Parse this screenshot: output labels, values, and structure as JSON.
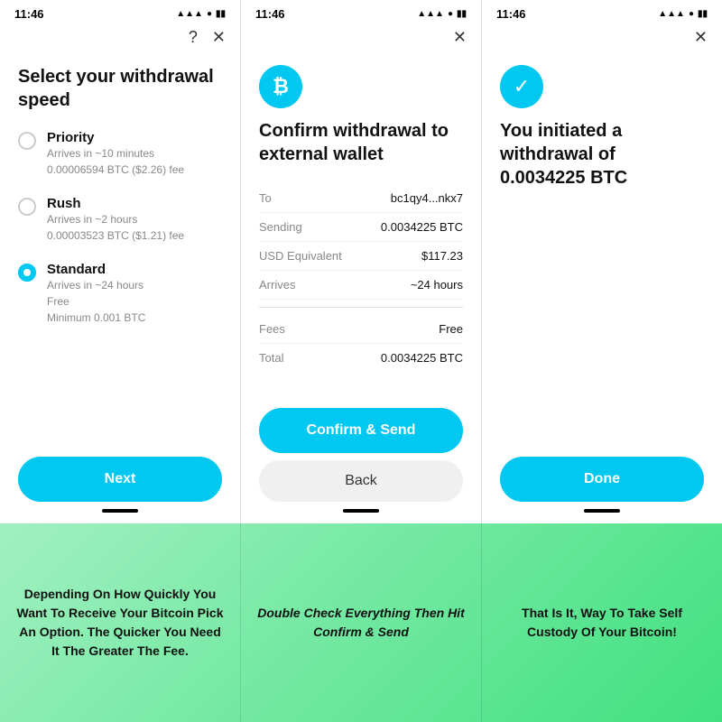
{
  "panels": [
    {
      "id": "panel1",
      "status_time": "11:46",
      "header_icons": [
        "?",
        "×"
      ],
      "title": "Select your withdrawal speed",
      "options": [
        {
          "id": "priority",
          "name": "Priority",
          "desc": "Arrives in ~10 minutes\n0.00006594 BTC ($2.26) fee",
          "selected": false
        },
        {
          "id": "rush",
          "name": "Rush",
          "desc": "Arrives in ~2 hours\n0.00003523 BTC ($1.21) fee",
          "selected": false
        },
        {
          "id": "standard",
          "name": "Standard",
          "desc": "Arrives in ~24 hours\nFree\nMinimum 0.001 BTC",
          "selected": true
        }
      ],
      "primary_button": "Next"
    },
    {
      "id": "panel2",
      "status_time": "11:46",
      "header_icons": [
        "×"
      ],
      "icon_type": "btc",
      "title": "Confirm withdrawal to external wallet",
      "details": [
        {
          "label": "To",
          "value": "bc1qy4...nkx7"
        },
        {
          "label": "Sending",
          "value": "0.0034225 BTC"
        },
        {
          "label": "USD Equivalent",
          "value": "$117.23"
        },
        {
          "label": "Arrives",
          "value": "~24 hours"
        }
      ],
      "fees": [
        {
          "label": "Fees",
          "value": "Free"
        },
        {
          "label": "Total",
          "value": "0.0034225 BTC"
        }
      ],
      "primary_button": "Confirm & Send",
      "secondary_button": "Back"
    },
    {
      "id": "panel3",
      "status_time": "11:46",
      "header_icons": [
        "×"
      ],
      "icon_type": "check",
      "title": "You initiated a withdrawal of 0.0034225 BTC",
      "primary_button": "Done"
    }
  ],
  "captions": [
    "Depending On How Quickly You Want To Receive Your Bitcoin Pick An Option. The Quicker You Need It The Greater The Fee.",
    "Double Check Everything Then Hit Confirm & Send",
    "That Is It, Way To Take Self Custody Of Your Bitcoin!"
  ]
}
